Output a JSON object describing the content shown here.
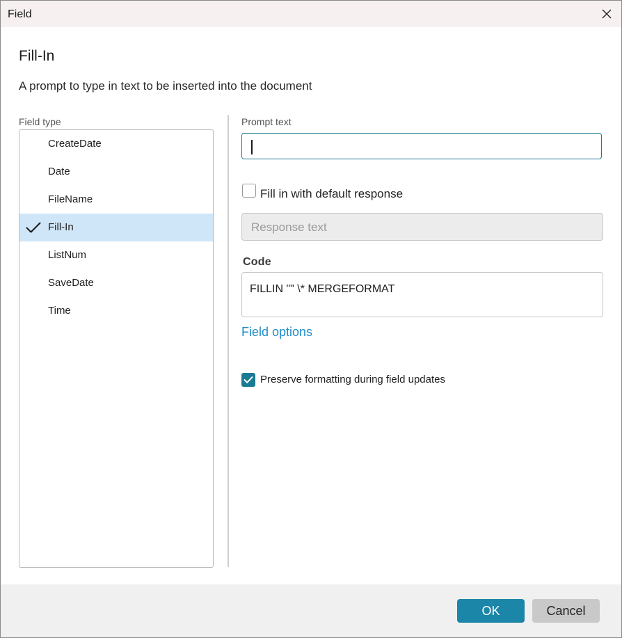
{
  "window": {
    "title": "Field",
    "close_icon": "close-icon"
  },
  "header": {
    "heading": "Fill-In",
    "description": "A prompt to type in text to be inserted into the document"
  },
  "field_type": {
    "label": "Field type",
    "selected": "Fill-In",
    "items": [
      {
        "label": "CreateDate",
        "selected": false
      },
      {
        "label": "Date",
        "selected": false
      },
      {
        "label": "FileName",
        "selected": false
      },
      {
        "label": "Fill-In",
        "selected": true
      },
      {
        "label": "ListNum",
        "selected": false
      },
      {
        "label": "SaveDate",
        "selected": false
      },
      {
        "label": "Time",
        "selected": false
      }
    ]
  },
  "prompt": {
    "label": "Prompt text",
    "value": ""
  },
  "default_response": {
    "checkbox_label": "Fill in with default response",
    "checked": false,
    "placeholder": "Response text"
  },
  "code": {
    "label": "Code",
    "value": "FILLIN \"\" \\* MERGEFORMAT"
  },
  "field_options": {
    "label": "Field options"
  },
  "preserve": {
    "label": "Preserve formatting during field updates",
    "checked": true
  },
  "buttons": {
    "ok": "OK",
    "cancel": "Cancel"
  },
  "colors": {
    "accent": "#1b7a94",
    "ok_button": "#1b86a8",
    "link": "#1f8cc7",
    "selected_item": "#cfe6f8",
    "titlebar": "#f7f0f1"
  }
}
